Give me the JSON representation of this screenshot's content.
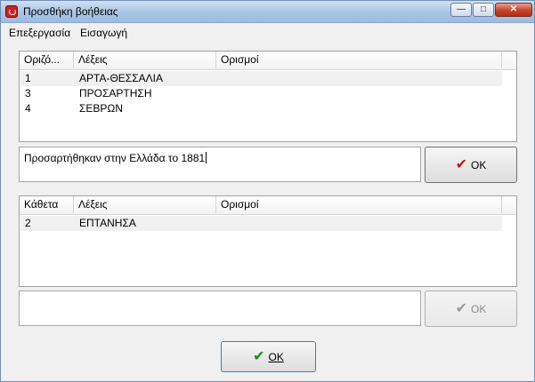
{
  "window": {
    "title": "Προσθήκη βοήθειας"
  },
  "titlebar_buttons": {
    "minimize": "—",
    "maximize": "□",
    "close": "✕"
  },
  "menu": {
    "items": [
      "Επεξεργασία",
      "Εισαγωγή"
    ]
  },
  "across_list": {
    "columns": [
      "Οριζό...",
      "Λέξεις",
      "Ορισμοί"
    ],
    "rows": [
      {
        "num": "1",
        "word": "ΑΡΤΑ-ΘΕΣΣΑΛΙΑ",
        "definition": ""
      },
      {
        "num": "3",
        "word": "ΠΡΟΣΑΡΤΗΣΗ",
        "definition": ""
      },
      {
        "num": "4",
        "word": "ΣΕΒΡΩΝ",
        "definition": ""
      }
    ]
  },
  "across_definition": {
    "value": "Προσαρτήθηκαν στην Ελλάδα το 1881"
  },
  "across_ok": {
    "label": "OK",
    "icon": "check-icon",
    "color": "#c41818"
  },
  "down_list": {
    "columns": [
      "Κάθετα",
      "Λέξεις",
      "Ορισμοί"
    ],
    "rows": [
      {
        "num": "2",
        "word": "ΕΠΤΑΝΗΣΑ",
        "definition": ""
      }
    ]
  },
  "down_definition": {
    "value": ""
  },
  "down_ok": {
    "label": "OK",
    "icon": "check-icon",
    "color": "#9a9a9a",
    "enabled": false
  },
  "main_ok": {
    "label": "OK",
    "icon": "check-icon",
    "color": "#1e8b1e"
  }
}
